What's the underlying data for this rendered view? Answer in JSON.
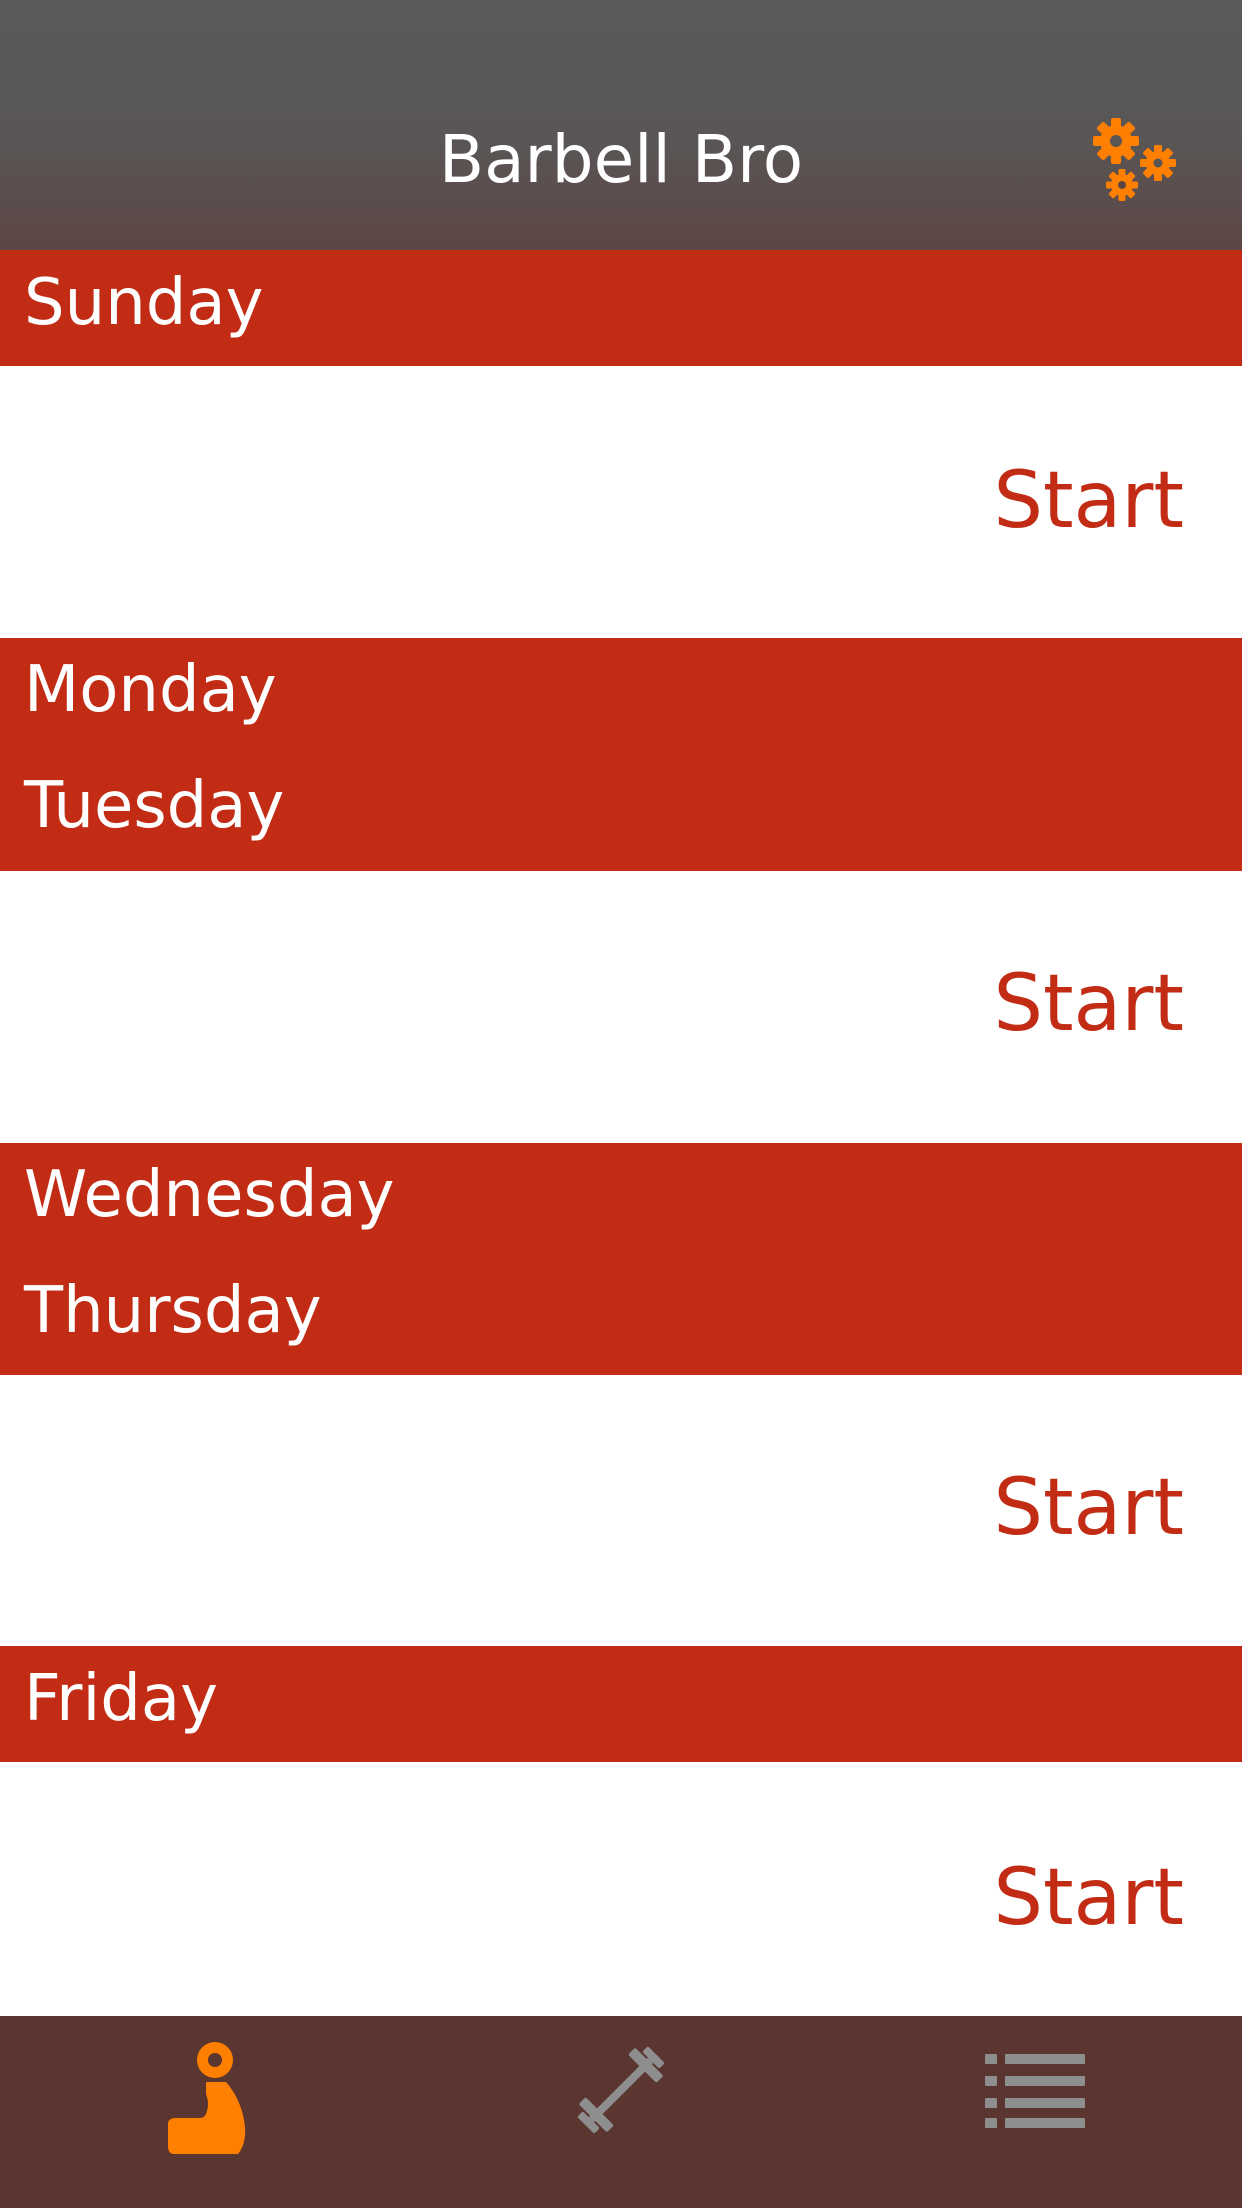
{
  "nav": {
    "title": "Barbell Bro",
    "settings_icon": "gears-icon",
    "accent_color": "#ff7f00"
  },
  "schedule": {
    "header_color": "#c22c15",
    "groups": [
      {
        "days": [
          "Sunday"
        ],
        "action_label": "Start"
      },
      {
        "days": [
          "Monday",
          "Tuesday"
        ],
        "action_label": "Start"
      },
      {
        "days": [
          "Wednesday",
          "Thursday"
        ],
        "action_label": "Start"
      },
      {
        "days": [
          "Friday"
        ],
        "action_label": "Start"
      }
    ]
  },
  "tabbar": {
    "tabs": [
      {
        "icon": "flexed-bicep-icon",
        "selected": true
      },
      {
        "icon": "barbell-icon",
        "selected": false
      },
      {
        "icon": "list-icon",
        "selected": false
      }
    ],
    "active_color": "#ff7f00",
    "inactive_color": "#8e8e8e"
  }
}
